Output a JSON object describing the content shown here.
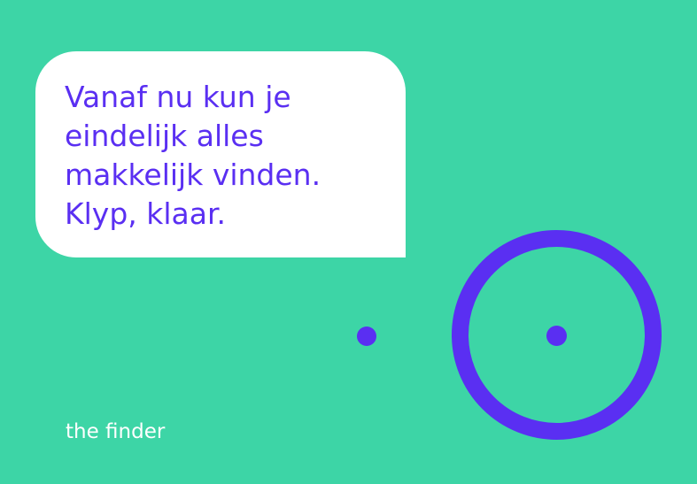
{
  "message": {
    "lines": [
      "Vanaf nu kun je",
      "eindelijk alles",
      "makkelijk vinden.",
      "Klyp, klaar."
    ]
  },
  "brand": {
    "tagline": "the finder"
  },
  "colors": {
    "background": "#3dd5a6",
    "bubble": "#ffffff",
    "accent": "#5a2ff2",
    "brand_text": "#ffffff"
  },
  "graphics": {
    "small_dot_icon": "dot-icon",
    "ring_icon": "target-ring-icon"
  }
}
